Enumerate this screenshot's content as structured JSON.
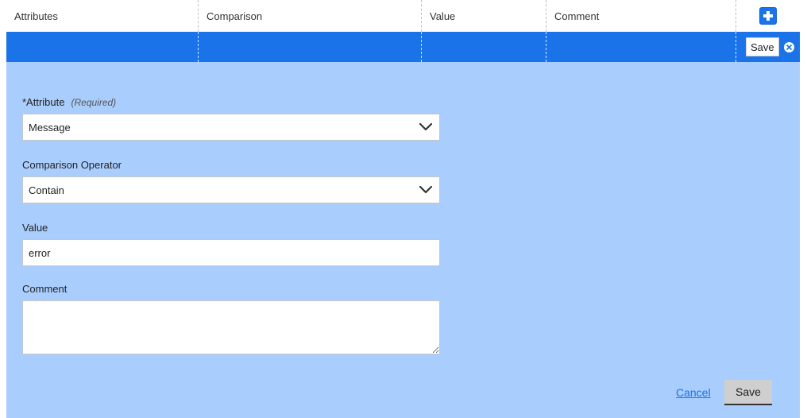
{
  "table": {
    "columns": [
      {
        "label": "Attributes"
      },
      {
        "label": "Comparison"
      },
      {
        "label": "Value"
      },
      {
        "label": "Comment"
      }
    ]
  },
  "edit_row": {
    "save_label": "Save"
  },
  "form": {
    "attribute": {
      "label": "*Attribute",
      "required_hint": "(Required)",
      "selected": "Message"
    },
    "operator": {
      "label": "Comparison Operator",
      "selected": "Contain"
    },
    "value": {
      "label": "Value",
      "current": "error"
    },
    "comment": {
      "label": "Comment",
      "current": ""
    },
    "cancel_label": "Cancel",
    "save_label": "Save"
  },
  "colors": {
    "accent": "#1a73e8",
    "panel": "#a9cdfd"
  },
  "icons": {
    "add": "plus-icon",
    "close": "close-circle-icon",
    "dropdown": "chevron-down-icon"
  }
}
